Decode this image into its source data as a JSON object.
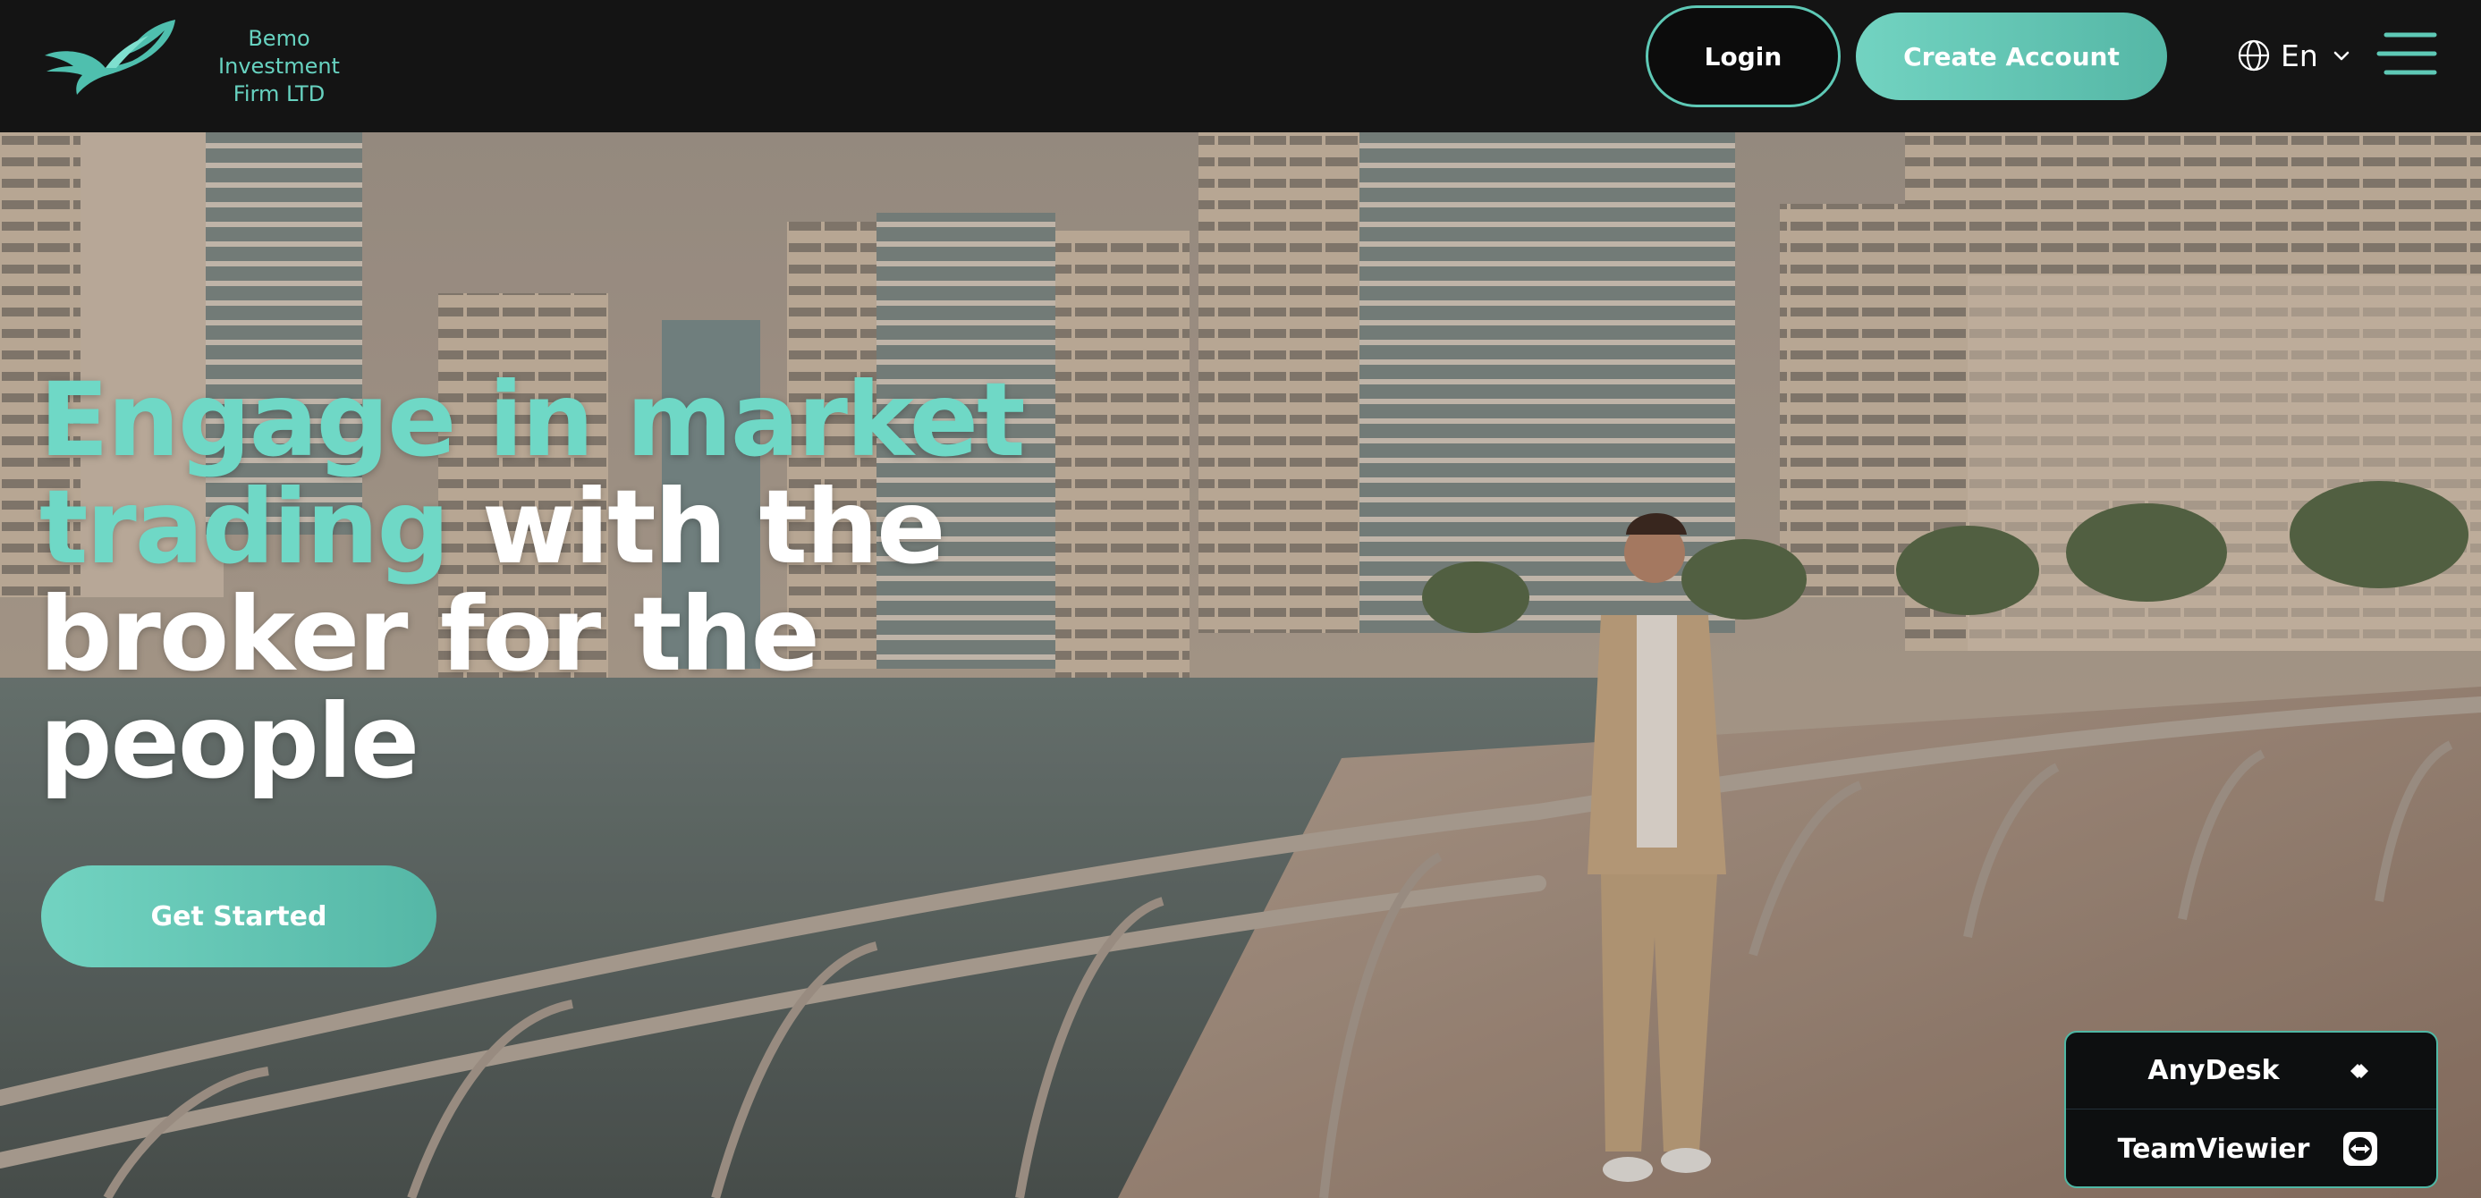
{
  "header": {
    "brand_name_line1": "Bemo Investment",
    "brand_name_line2": "Firm LTD",
    "login_label": "Login",
    "create_account_label": "Create Account",
    "language": "En"
  },
  "hero": {
    "headline_accent_1": "Engage in market",
    "headline_accent_2": "trading",
    "headline_plain_1": " with the",
    "headline_plain_2": "broker for the",
    "headline_plain_3": "people",
    "cta_label": "Get Started"
  },
  "remote_support": {
    "anydesk_label": "AnyDesk",
    "teamviewer_label": "TeamViewier"
  },
  "colors": {
    "accent": "#6fd8c6",
    "header_bg": "#141414",
    "button_gradient_start": "#72d3c1",
    "button_gradient_end": "#55b7a6"
  },
  "icons": {
    "logo": "bird-logo-icon",
    "language": "globe-icon",
    "language_toggle": "chevron-down-icon",
    "menu": "hamburger-menu-icon",
    "anydesk": "anydesk-icon",
    "teamviewer": "teamviewer-icon"
  }
}
